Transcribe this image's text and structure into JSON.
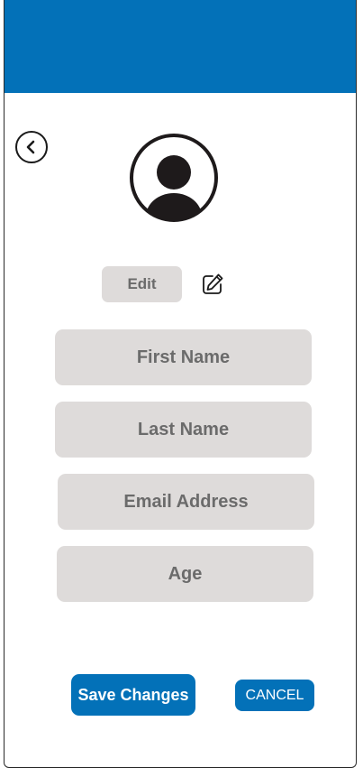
{
  "header": {
    "color": "#0371b8"
  },
  "nav": {
    "back_icon": "chevron-left-icon"
  },
  "profile": {
    "avatar_icon": "user-avatar-icon",
    "edit_label": "Edit",
    "edit_icon": "pencil-square-icon"
  },
  "form": {
    "first_name_placeholder": "First Name",
    "last_name_placeholder": "Last Name",
    "email_placeholder": "Email Address",
    "age_placeholder": "Age"
  },
  "actions": {
    "save_label": "Save Changes",
    "cancel_label": "CANCEL"
  },
  "colors": {
    "primary": "#0371b8",
    "field_bg": "#dedbda",
    "field_text": "#6b6b6b"
  }
}
